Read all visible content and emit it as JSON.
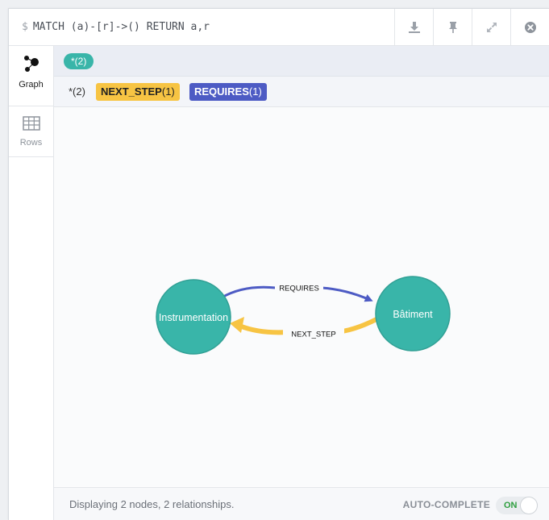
{
  "query": {
    "prompt": "$",
    "text": "MATCH (a)-[r]->() RETURN a,r"
  },
  "header_buttons": [
    {
      "name": "download-icon"
    },
    {
      "name": "pin-icon"
    },
    {
      "name": "expand-icon"
    },
    {
      "name": "close-icon"
    }
  ],
  "sidebar": {
    "items": [
      {
        "label": "Graph",
        "icon": "graph-icon",
        "active": true
      },
      {
        "label": "Rows",
        "icon": "table-icon",
        "active": false
      }
    ]
  },
  "legend": {
    "nodes_pill": "*(2)",
    "rel_all": "*(2)",
    "relationships": [
      {
        "type": "NEXT_STEP",
        "count": "(1)",
        "color": "#f7c443"
      },
      {
        "type": "REQUIRES",
        "count": "(1)",
        "color": "#4d5bc4"
      }
    ]
  },
  "graph": {
    "node_color": "#39b5a9",
    "nodes": [
      {
        "label": "Instrumentation"
      },
      {
        "label": "Bâtiment"
      }
    ],
    "edges": [
      {
        "label": "REQUIRES",
        "color": "#4d5bc4"
      },
      {
        "label": "NEXT_STEP",
        "color": "#f7c443"
      }
    ]
  },
  "footer": {
    "status": "Displaying 2 nodes, 2 relationships.",
    "autocomplete_label": "AUTO-COMPLETE",
    "toggle_state": "ON"
  }
}
